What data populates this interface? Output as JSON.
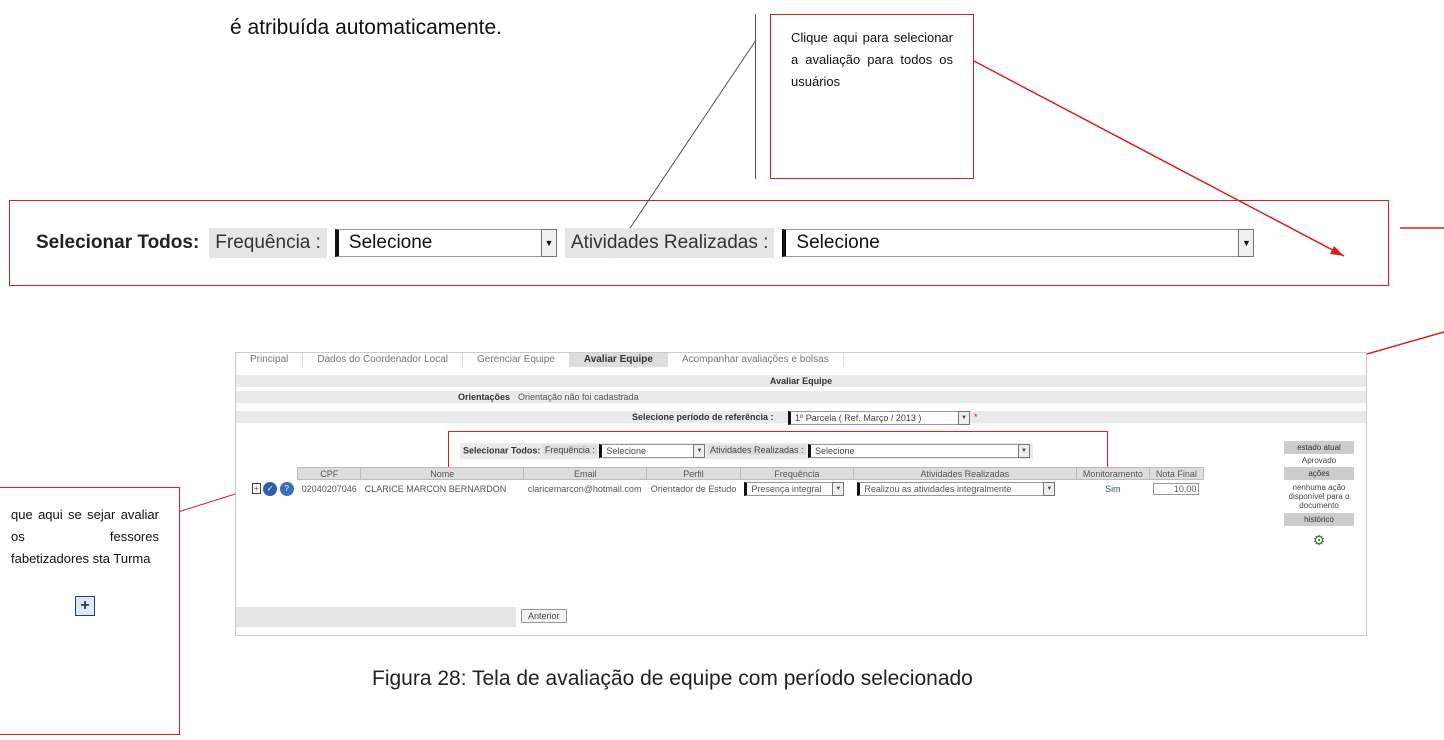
{
  "intro_text": "é atribuída automaticamente.",
  "callout_select_all": "Clique aqui para selecionar a avaliação para todos os usuários",
  "callout_expand": "que aqui se sejar avaliar os fessores fabetizadores sta Turma",
  "select_all_bar": {
    "title": "Selecionar Todos:",
    "frequencia_label": "Frequência :",
    "frequencia_value": "Selecione",
    "atividades_label": "Atividades Realizadas :",
    "atividades_value": "Selecione"
  },
  "screen": {
    "tabs": [
      "Principal",
      "Dados do Coordenador Local",
      "Gerenciar Equipe",
      "Avaliar Equipe",
      "Acompanhar avaliações e bolsas"
    ],
    "active_tab": 3,
    "section_title": "Avaliar Equipe",
    "orientacoes_label": "Orientações",
    "orientacoes_value": "Orientação não foi cadastrada",
    "periodo_label": "Selecione período de referência :",
    "periodo_value": "1º Parcela ( Ref. Março / 2013 )",
    "mini_select_all": {
      "title": "Selecionar Todos:",
      "frequencia_label": "Frequência :",
      "frequencia_value": "Selecione",
      "atividades_label": "Atividades Realizadas :",
      "atividades_value": "Selecione"
    },
    "table": {
      "headers": [
        "CPF",
        "Nome",
        "Email",
        "Perfil",
        "Frequência",
        "Atividades Realizadas",
        "Monitoramento",
        "Nota Final"
      ],
      "row": {
        "cpf": "02040207046",
        "nome": "CLARICE MARCON BERNARDON",
        "email": "claricemarcon@hotmail.com",
        "perfil": "Orientador de Estudo",
        "frequencia": "Presença integral",
        "atividades": "Realizou as atividades integralmente",
        "monitoramento": "Sim",
        "nota_final": "10,00"
      }
    },
    "side": {
      "estado_label": "estado atual",
      "estado_value": "Aprovado",
      "acoes_label": "ações",
      "acoes_value": "nenhuma ação disponível para o documento",
      "historico_label": "histórico"
    },
    "back_button": "Anterior"
  },
  "caption": "Figura 28: Tela de avaliação de equipe com período selecionado"
}
